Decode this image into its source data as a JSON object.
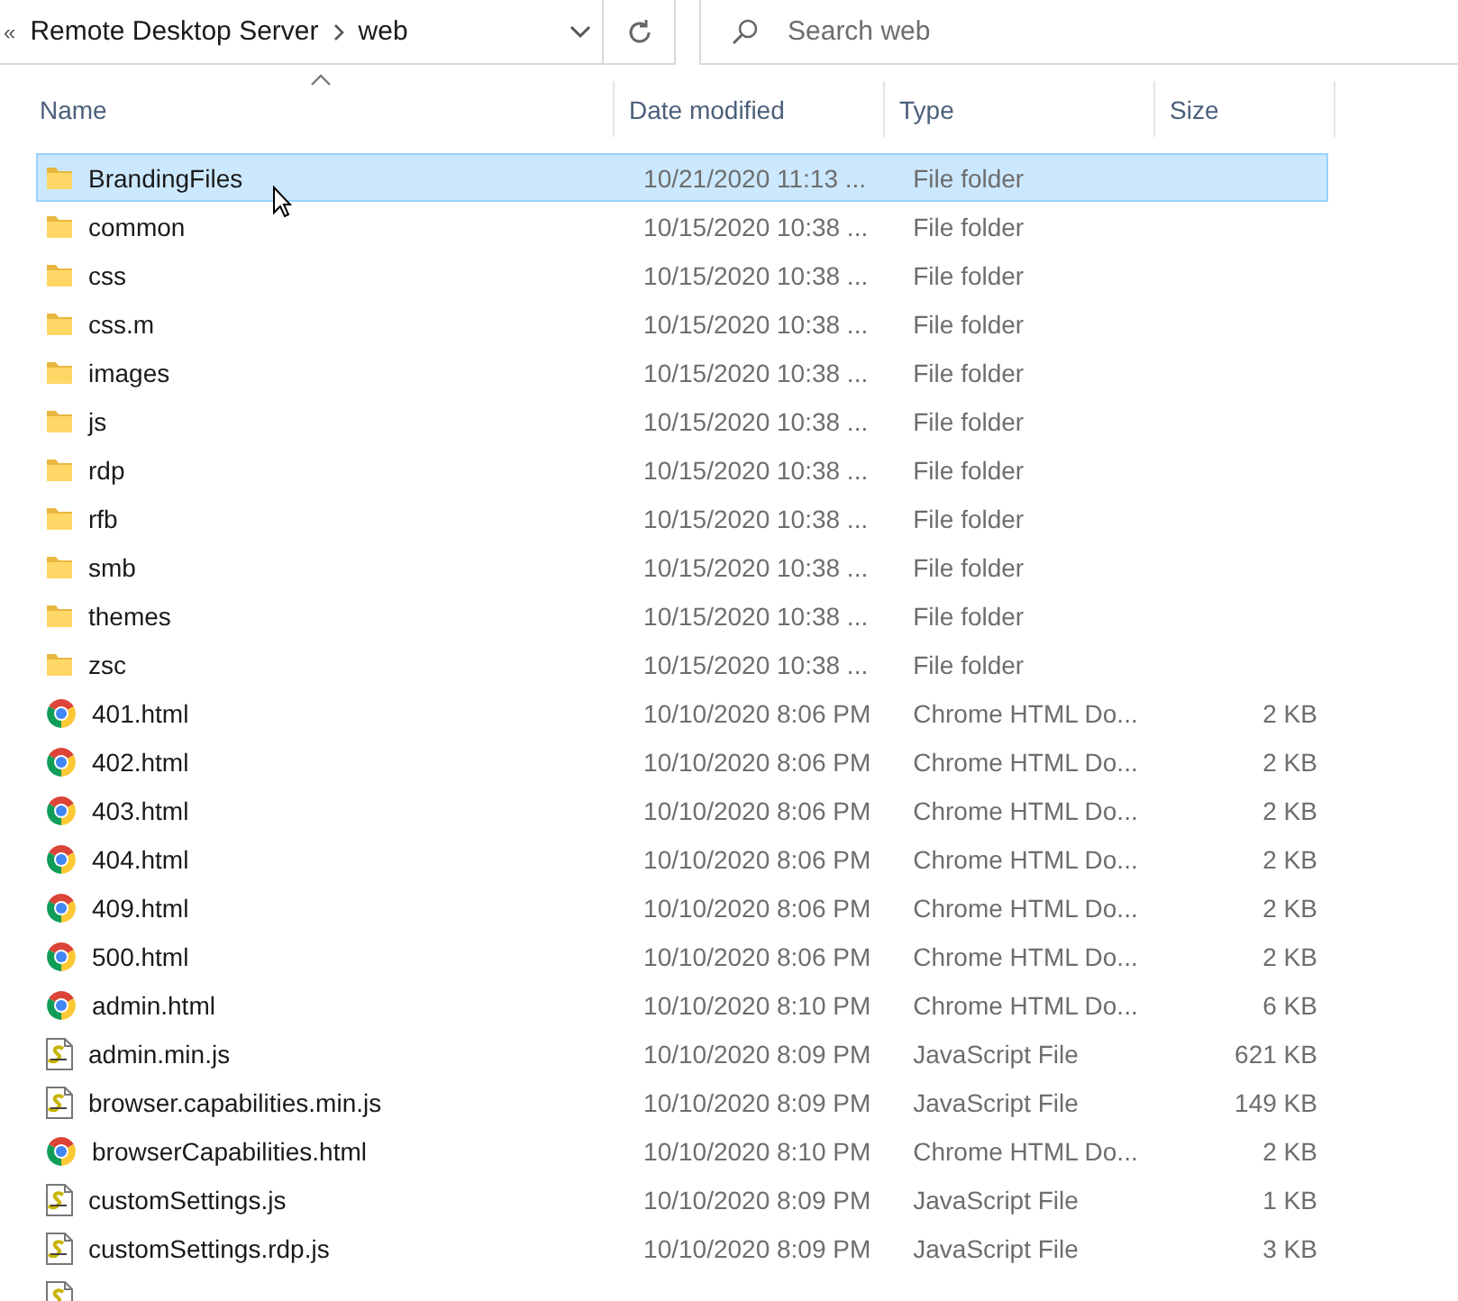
{
  "address_bar": {
    "overflow": "«",
    "path": [
      "Remote Desktop Server",
      "web"
    ]
  },
  "search": {
    "placeholder": "Search web"
  },
  "columns": [
    {
      "label": "Name",
      "sorted": true
    },
    {
      "label": "Date modified",
      "sorted": false
    },
    {
      "label": "Type",
      "sorted": false
    },
    {
      "label": "Size",
      "sorted": false
    }
  ],
  "rows": [
    {
      "kind": "folder",
      "name": "BrandingFiles",
      "date": "10/21/2020 11:13 ...",
      "type": "File folder",
      "selected": true
    },
    {
      "kind": "folder",
      "name": "common",
      "date": "10/15/2020 10:38 ...",
      "type": "File folder",
      "selected": false
    },
    {
      "kind": "folder",
      "name": "css",
      "date": "10/15/2020 10:38 ...",
      "type": "File folder",
      "selected": false
    },
    {
      "kind": "folder",
      "name": "css.m",
      "date": "10/15/2020 10:38 ...",
      "type": "File folder",
      "selected": false
    },
    {
      "kind": "folder",
      "name": "images",
      "date": "10/15/2020 10:38 ...",
      "type": "File folder",
      "selected": false
    },
    {
      "kind": "folder",
      "name": "js",
      "date": "10/15/2020 10:38 ...",
      "type": "File folder",
      "selected": false
    },
    {
      "kind": "folder",
      "name": "rdp",
      "date": "10/15/2020 10:38 ...",
      "type": "File folder",
      "selected": false
    },
    {
      "kind": "folder",
      "name": "rfb",
      "date": "10/15/2020 10:38 ...",
      "type": "File folder",
      "selected": false
    },
    {
      "kind": "folder",
      "name": "smb",
      "date": "10/15/2020 10:38 ...",
      "type": "File folder",
      "selected": false
    },
    {
      "kind": "folder",
      "name": "themes",
      "date": "10/15/2020 10:38 ...",
      "type": "File folder",
      "selected": false
    },
    {
      "kind": "folder",
      "name": "zsc",
      "date": "10/15/2020 10:38 ...",
      "type": "File folder",
      "selected": false
    },
    {
      "kind": "chrome",
      "name": "401.html",
      "date": "10/10/2020 8:06 PM",
      "type": "Chrome HTML Do...",
      "size": "2 KB",
      "selected": false
    },
    {
      "kind": "chrome",
      "name": "402.html",
      "date": "10/10/2020 8:06 PM",
      "type": "Chrome HTML Do...",
      "size": "2 KB",
      "selected": false
    },
    {
      "kind": "chrome",
      "name": "403.html",
      "date": "10/10/2020 8:06 PM",
      "type": "Chrome HTML Do...",
      "size": "2 KB",
      "selected": false
    },
    {
      "kind": "chrome",
      "name": "404.html",
      "date": "10/10/2020 8:06 PM",
      "type": "Chrome HTML Do...",
      "size": "2 KB",
      "selected": false
    },
    {
      "kind": "chrome",
      "name": "409.html",
      "date": "10/10/2020 8:06 PM",
      "type": "Chrome HTML Do...",
      "size": "2 KB",
      "selected": false
    },
    {
      "kind": "chrome",
      "name": "500.html",
      "date": "10/10/2020 8:06 PM",
      "type": "Chrome HTML Do...",
      "size": "2 KB",
      "selected": false
    },
    {
      "kind": "chrome",
      "name": "admin.html",
      "date": "10/10/2020 8:10 PM",
      "type": "Chrome HTML Do...",
      "size": "6 KB",
      "selected": false
    },
    {
      "kind": "js",
      "name": "admin.min.js",
      "date": "10/10/2020 8:09 PM",
      "type": "JavaScript File",
      "size": "621 KB",
      "selected": false
    },
    {
      "kind": "js",
      "name": "browser.capabilities.min.js",
      "date": "10/10/2020 8:09 PM",
      "type": "JavaScript File",
      "size": "149 KB",
      "selected": false
    },
    {
      "kind": "chrome",
      "name": "browserCapabilities.html",
      "date": "10/10/2020 8:10 PM",
      "type": "Chrome HTML Do...",
      "size": "2 KB",
      "selected": false
    },
    {
      "kind": "js",
      "name": "customSettings.js",
      "date": "10/10/2020 8:09 PM",
      "type": "JavaScript File",
      "size": "1 KB",
      "selected": false
    },
    {
      "kind": "js",
      "name": "customSettings.rdp.js",
      "date": "10/10/2020 8:09 PM",
      "type": "JavaScript File",
      "size": "3 KB",
      "selected": false
    },
    {
      "kind": "js",
      "selected": false
    }
  ]
}
